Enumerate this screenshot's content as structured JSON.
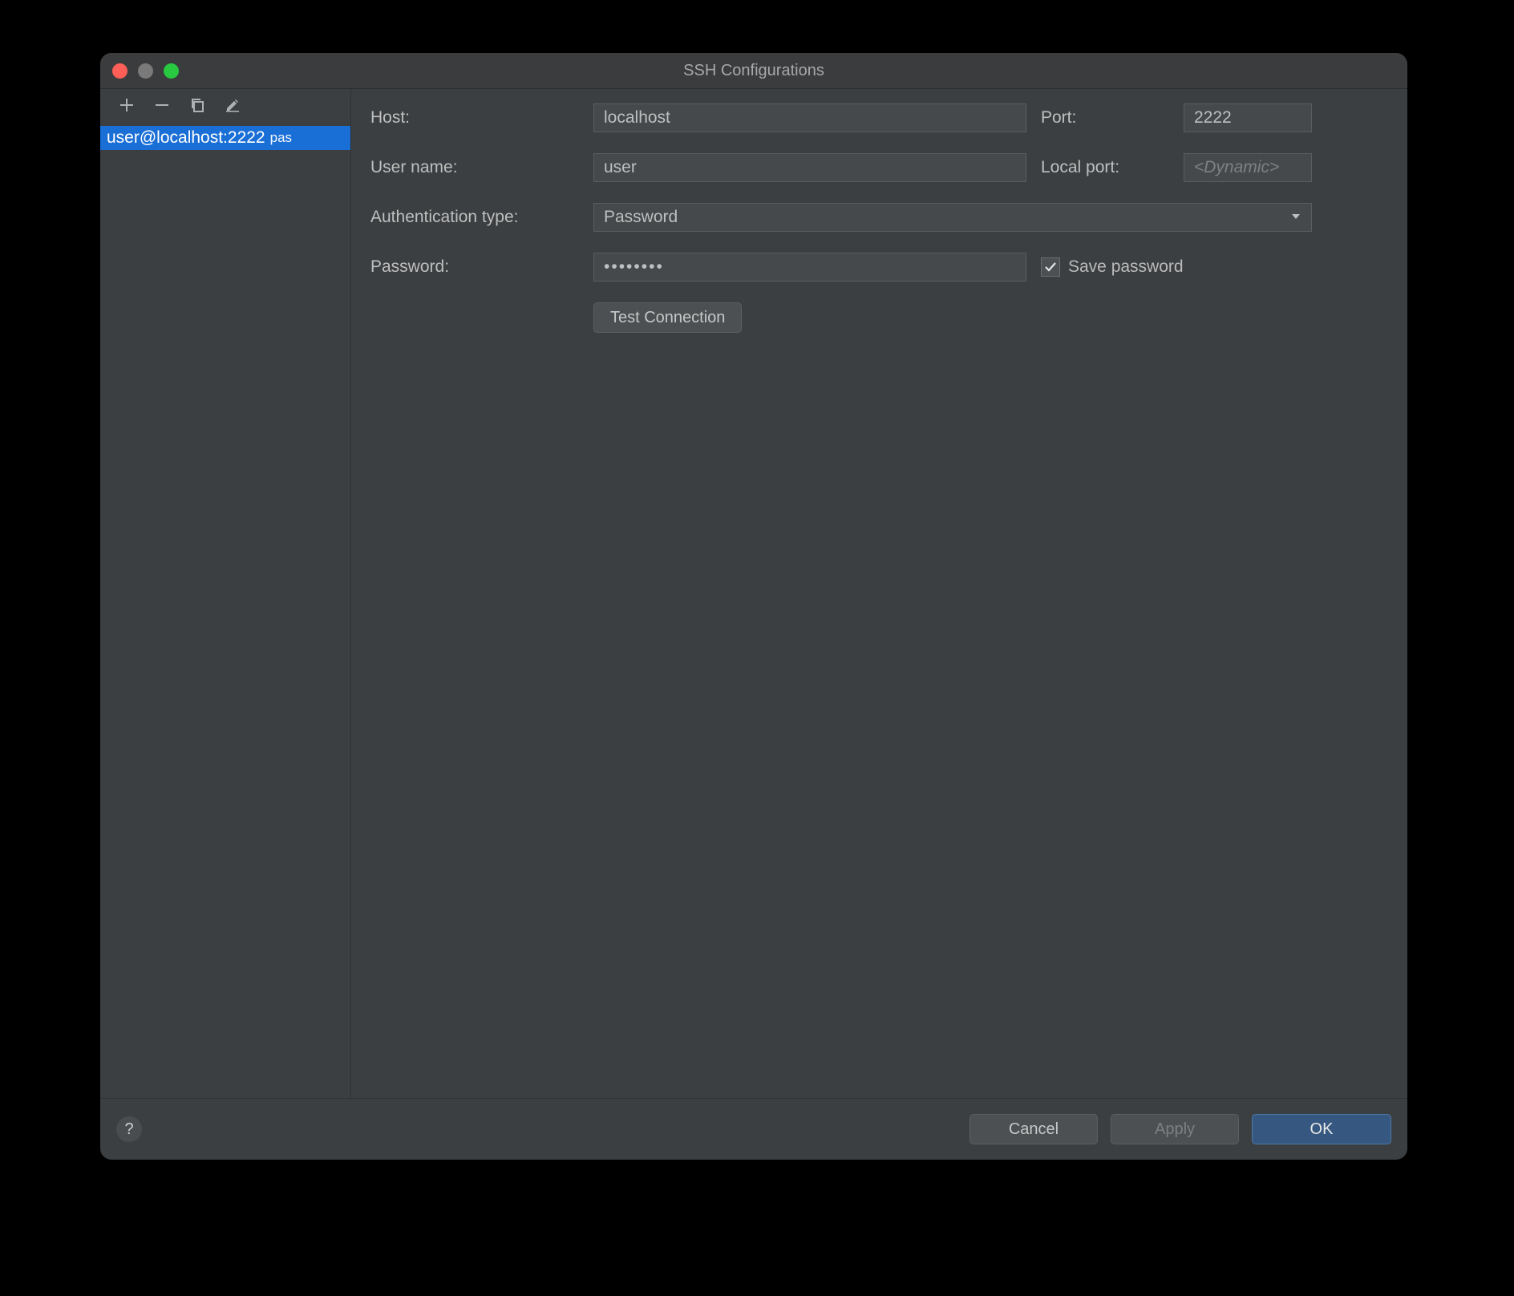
{
  "window": {
    "title": "SSH Configurations"
  },
  "sidebar": {
    "items": [
      {
        "label": "user@localhost:2222",
        "suffix": "pas",
        "selected": true
      }
    ]
  },
  "form": {
    "host_label": "Host:",
    "host_value": "localhost",
    "port_label": "Port:",
    "port_value": "2222",
    "username_label": "User name:",
    "username_value": "user",
    "local_port_label": "Local port:",
    "local_port_placeholder": "<Dynamic>",
    "local_port_value": "",
    "auth_type_label": "Authentication type:",
    "auth_type_value": "Password",
    "password_label": "Password:",
    "password_value": "••••••••",
    "save_password_label": "Save password",
    "save_password_checked": true,
    "test_connection_label": "Test Connection"
  },
  "footer": {
    "help_label": "?",
    "cancel_label": "Cancel",
    "apply_label": "Apply",
    "ok_label": "OK"
  }
}
